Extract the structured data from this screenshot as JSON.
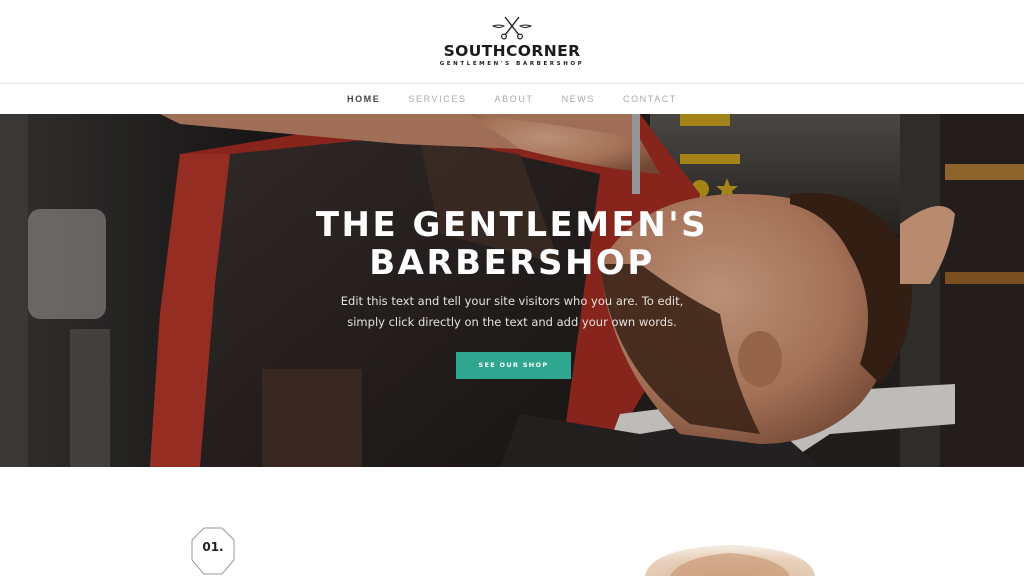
{
  "brand": {
    "name": "SOUTHCORNER",
    "tagline": "GENTLEMEN'S BARBERSHOP",
    "logo_icon": "crossed-scissors-icon"
  },
  "nav": {
    "items": [
      {
        "label": "HOME",
        "active": true
      },
      {
        "label": "SERVICES",
        "active": false
      },
      {
        "label": "ABOUT",
        "active": false
      },
      {
        "label": "NEWS",
        "active": false
      },
      {
        "label": "CONTACT",
        "active": false
      }
    ]
  },
  "hero": {
    "title_line1": "THE GENTLEMEN'S",
    "title_line2": "BARBERSHOP",
    "text_line1": "Edit this text and tell your site visitors who you are. To edit,",
    "text_line2": "simply click directly on the text and add your own words.",
    "button_label": "SEE OUR SHOP",
    "button_color": "#2fa68f"
  },
  "section": {
    "step_number": "01."
  }
}
